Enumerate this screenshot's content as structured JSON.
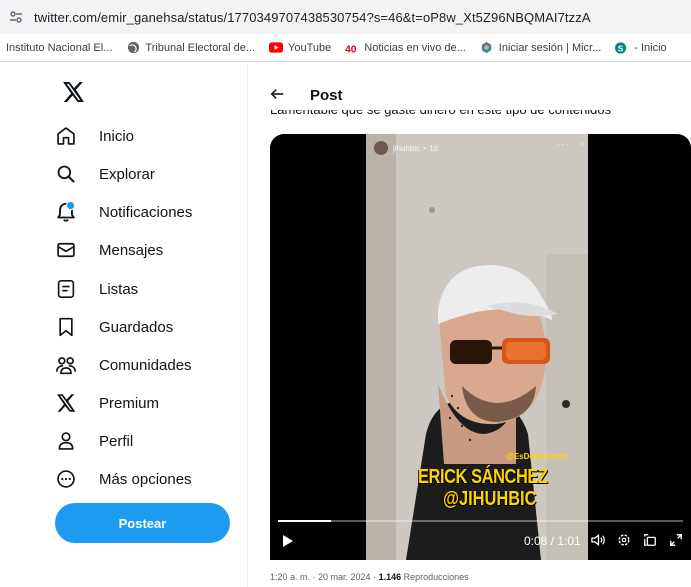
{
  "browser": {
    "url": "twitter.com/emir_ganehsa/status/1770349707438530754?s=46&t=oP8w_Xt5Z96NBQMAI7tzzA",
    "bookmarks": [
      {
        "label": "Instituto Nacional El...",
        "icon": "none"
      },
      {
        "label": "Tribunal Electoral de...",
        "icon": "globe-icon"
      },
      {
        "label": "YouTube",
        "icon": "youtube-icon"
      },
      {
        "label": "Noticias en vivo de...",
        "icon": "news-icon"
      },
      {
        "label": "Iniciar sesión | Micr...",
        "icon": "microsoft-icon"
      },
      {
        "label": "- Inicio",
        "icon": "sharepoint-icon"
      }
    ]
  },
  "sidebar": {
    "items": [
      {
        "label": "Inicio",
        "icon": "home-icon"
      },
      {
        "label": "Explorar",
        "icon": "search-icon"
      },
      {
        "label": "Notificaciones",
        "icon": "bell-icon"
      },
      {
        "label": "Mensajes",
        "icon": "envelope-icon"
      },
      {
        "label": "Listas",
        "icon": "list-icon"
      },
      {
        "label": "Guardados",
        "icon": "bookmark-icon"
      },
      {
        "label": "Comunidades",
        "icon": "communities-icon"
      },
      {
        "label": "Premium",
        "icon": "x-logo-icon"
      },
      {
        "label": "Perfil",
        "icon": "person-icon"
      },
      {
        "label": "Más opciones",
        "icon": "more-circle-icon"
      }
    ],
    "post_button": "Postear"
  },
  "header": {
    "title": "Post"
  },
  "tweet": {
    "text": "Lamentable que se gaste dinero en este tipo de contenidos",
    "video": {
      "story_user": "jihuhbic",
      "story_age": "1d",
      "handle_overlay": "@EsDeMamador",
      "caption_line1": "ERICK SÁNCHEZ",
      "caption_line2": "@JIHUHBIC",
      "time": "0:08 / 1:01",
      "progress": 0.13
    },
    "meta": {
      "timestamp": "1:20 a. m. · 20 mar. 2024 · ",
      "views": "1.146",
      "views_label": " Reproducciones"
    }
  },
  "colors": {
    "accent": "#1d9bf0",
    "caption": "#ffd400"
  }
}
